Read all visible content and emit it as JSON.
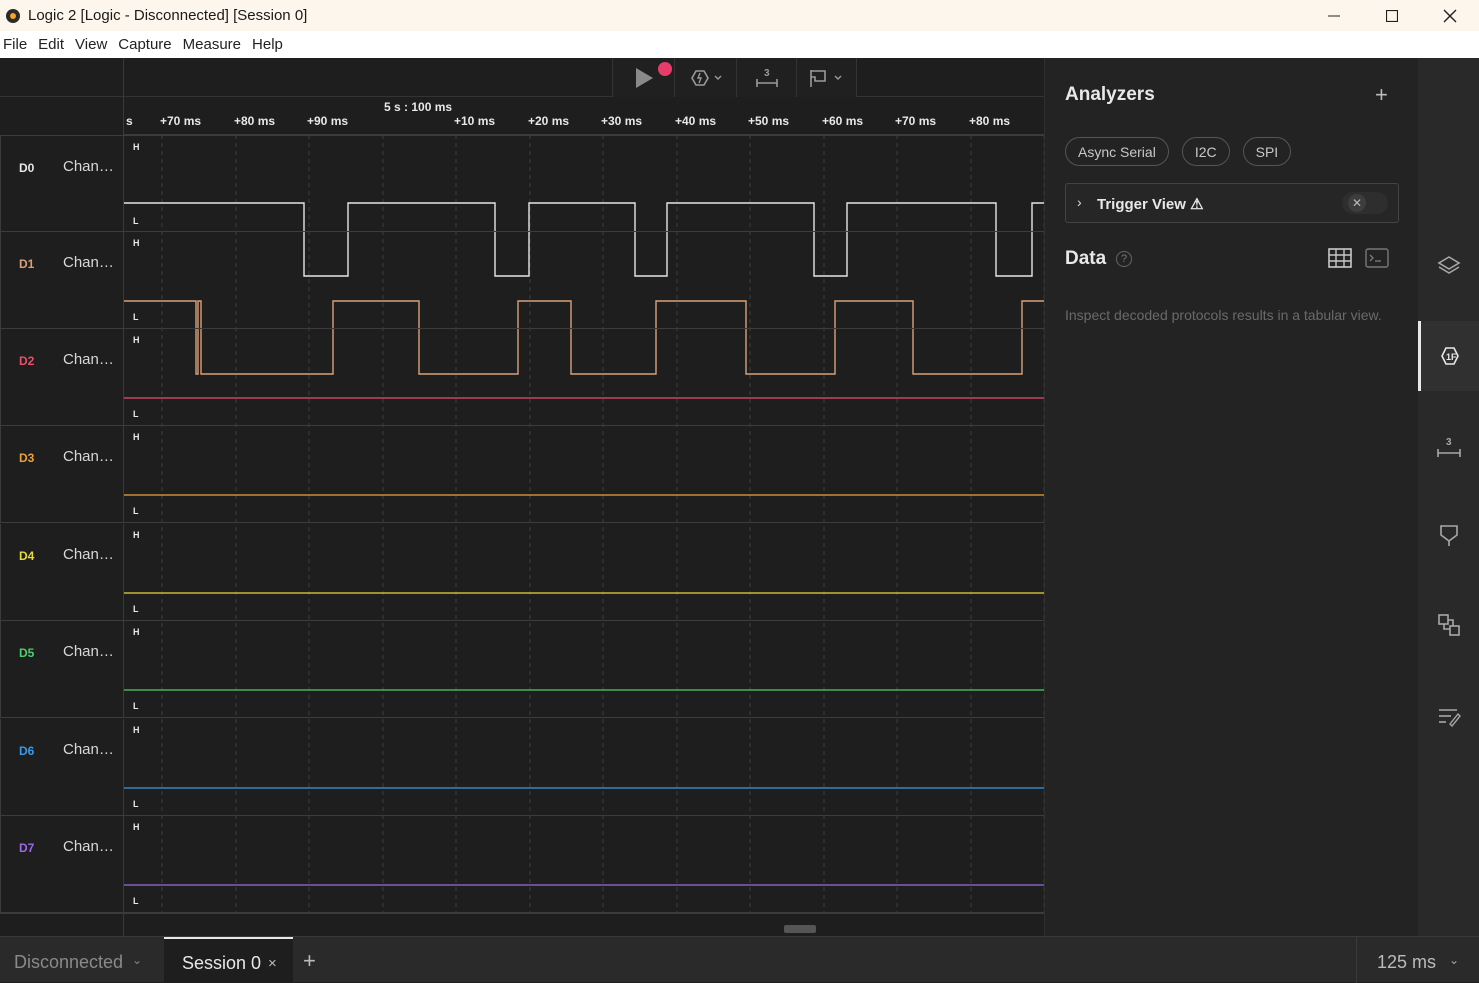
{
  "window": {
    "title": "Logic 2 [Logic - Disconnected] [Session 0]",
    "controls": [
      "minimize",
      "maximize",
      "close"
    ]
  },
  "menu": [
    "File",
    "Edit",
    "View",
    "Capture",
    "Measure",
    "Help"
  ],
  "timeline": {
    "center_label": "5 s : 100 ms",
    "ticks": [
      "s",
      "+70 ms",
      "+80 ms",
      "+90 ms",
      "+10 ms",
      "+20 ms",
      "+30 ms",
      "+40 ms",
      "+50 ms",
      "+60 ms",
      "+70 ms",
      "+80 ms"
    ]
  },
  "channels": [
    {
      "id": "D0",
      "name": "Chan…",
      "high": "H",
      "low": "L",
      "color": "#e6e6e6"
    },
    {
      "id": "D1",
      "name": "Chan…",
      "high": "H",
      "low": "L",
      "color": "#d8a07a"
    },
    {
      "id": "D2",
      "name": "Chan…",
      "high": "H",
      "low": "L",
      "color": "#e8506a"
    },
    {
      "id": "D3",
      "name": "Chan…",
      "high": "H",
      "low": "L",
      "color": "#f0a03a"
    },
    {
      "id": "D4",
      "name": "Chan…",
      "high": "H",
      "low": "L",
      "color": "#e8d83a"
    },
    {
      "id": "D5",
      "name": "Chan…",
      "high": "H",
      "low": "L",
      "color": "#4ccf6a"
    },
    {
      "id": "D6",
      "name": "Chan…",
      "high": "H",
      "low": "L",
      "color": "#3a9ae8"
    },
    {
      "id": "D7",
      "name": "Chan…",
      "high": "H",
      "low": "L",
      "color": "#9a6ae8"
    }
  ],
  "analyzers": {
    "title": "Analyzers",
    "add": "+",
    "chips": [
      "Async Serial",
      "I2C",
      "SPI"
    ],
    "trigger_view": "Trigger View ⚠",
    "trigger_close": "✕"
  },
  "data_panel": {
    "title": "Data",
    "help": "?",
    "description": "Inspect decoded protocols results in a tabular view."
  },
  "rail_icons": [
    "layers-icon",
    "analyzer-icon",
    "measure-icon",
    "marker-icon",
    "extensions-icon",
    "notes-icon"
  ],
  "status": {
    "device": "Disconnected",
    "session_tab": "Session 0",
    "session_close": "×",
    "add_tab": "+",
    "zoom": "125 ms"
  }
}
